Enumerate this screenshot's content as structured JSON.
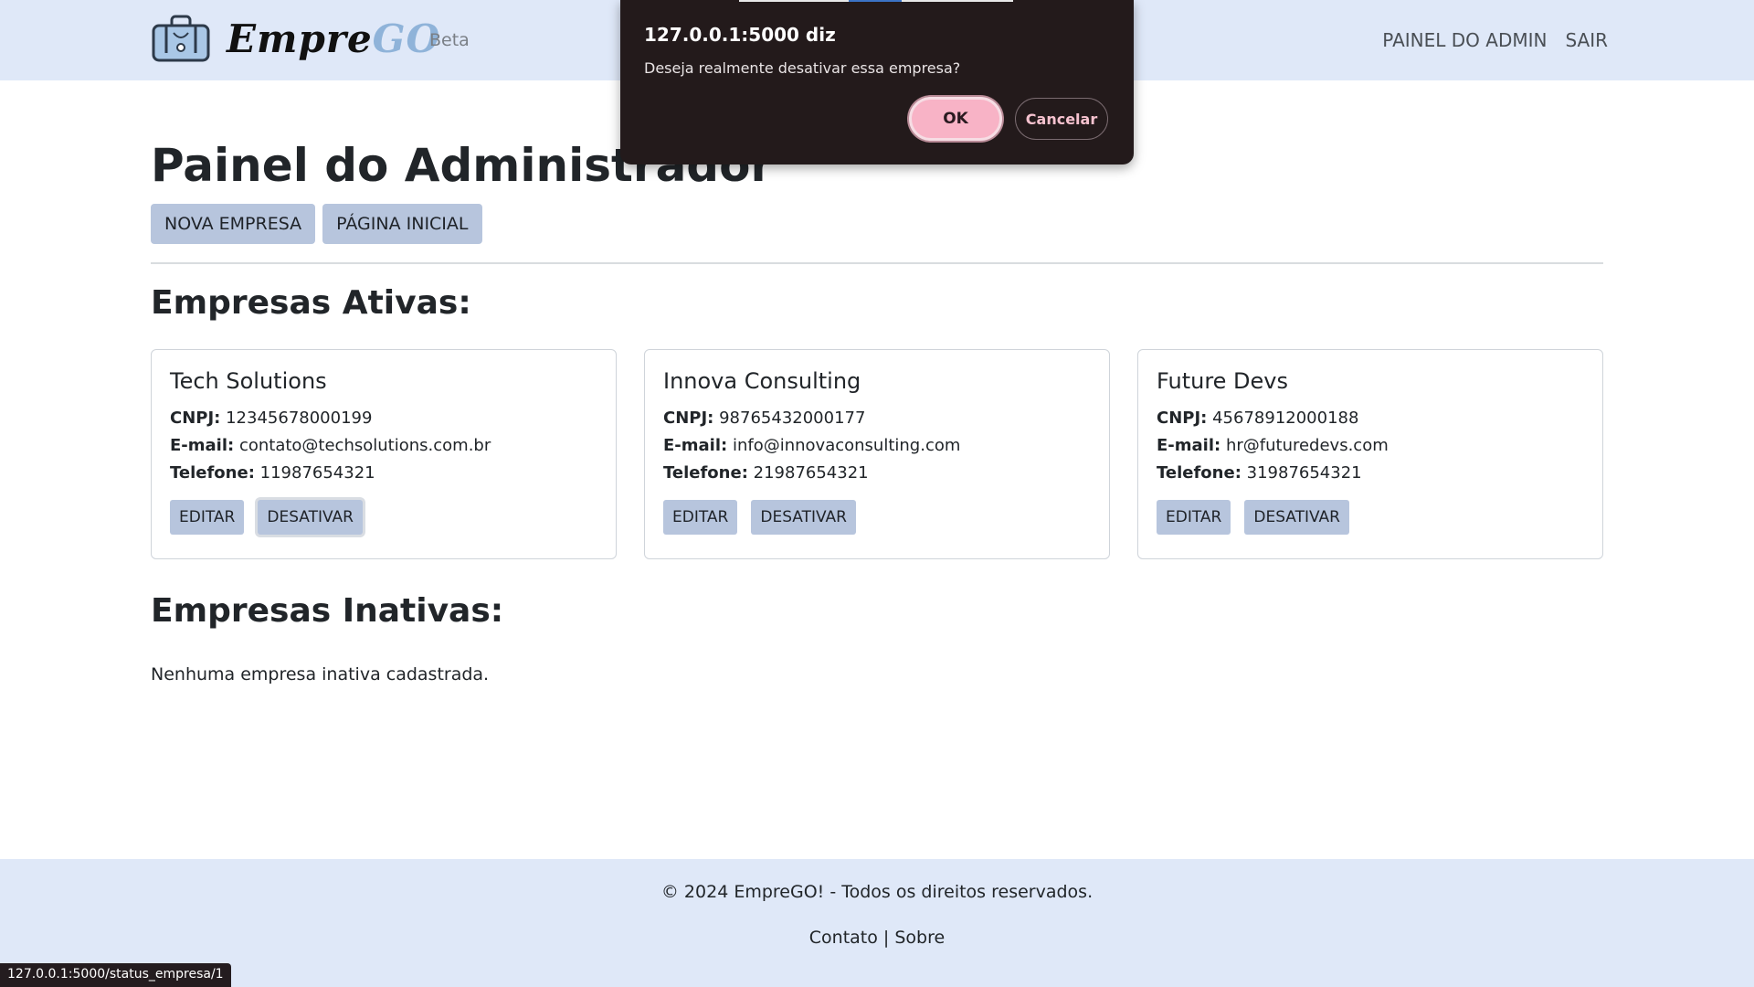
{
  "navbar": {
    "brand_part1": "Empre",
    "brand_part2": "GO",
    "beta": "Beta",
    "links": [
      "PAINEL DO ADMIN",
      "SAIR"
    ]
  },
  "main": {
    "title": "Painel do Administrador",
    "buttons": [
      "NOVA EMPRESA",
      "PÁGINA INICIAL"
    ],
    "active_title": "Empresas Ativas:",
    "inactive_title": "Empresas Inativas:",
    "inactive_empty": "Nenhuma empresa inativa cadastrada.",
    "labels": {
      "cnpj": "CNPJ:",
      "email": "E-mail:",
      "phone": "Telefone:"
    },
    "companies": [
      {
        "name": "Tech Solutions",
        "cnpj": "12345678000199",
        "email": "contato@techsolutions.com.br",
        "phone": "11987654321",
        "edit": "EDITAR",
        "deactivate": "DESATIVAR"
      },
      {
        "name": "Innova Consulting",
        "cnpj": "98765432000177",
        "email": "info@innovaconsulting.com",
        "phone": "21987654321",
        "edit": "EDITAR",
        "deactivate": "DESATIVAR"
      },
      {
        "name": "Future Devs",
        "cnpj": "45678912000188",
        "email": "hr@futuredevs.com",
        "phone": "31987654321",
        "edit": "EDITAR",
        "deactivate": "DESATIVAR"
      }
    ]
  },
  "footer": {
    "copyright": "© 2024 EmpreGO! - Todos os direitos reservados.",
    "link_contact": "Contato",
    "separator": "|",
    "link_about": "Sobre"
  },
  "statusbar": {
    "url": "127.0.0.1:5000/status_empresa/1"
  },
  "dialog": {
    "title": "127.0.0.1:5000 diz",
    "message": "Deseja realmente desativar essa empresa?",
    "ok": "OK",
    "cancel": "Cancelar"
  },
  "colors": {
    "navbar_bg": "#dfe8f8",
    "button_bg": "#b7c5dd",
    "dialog_bg": "#231a1b",
    "ok_bg": "#f8b3c6",
    "brand_go": "#8fb3d9"
  }
}
